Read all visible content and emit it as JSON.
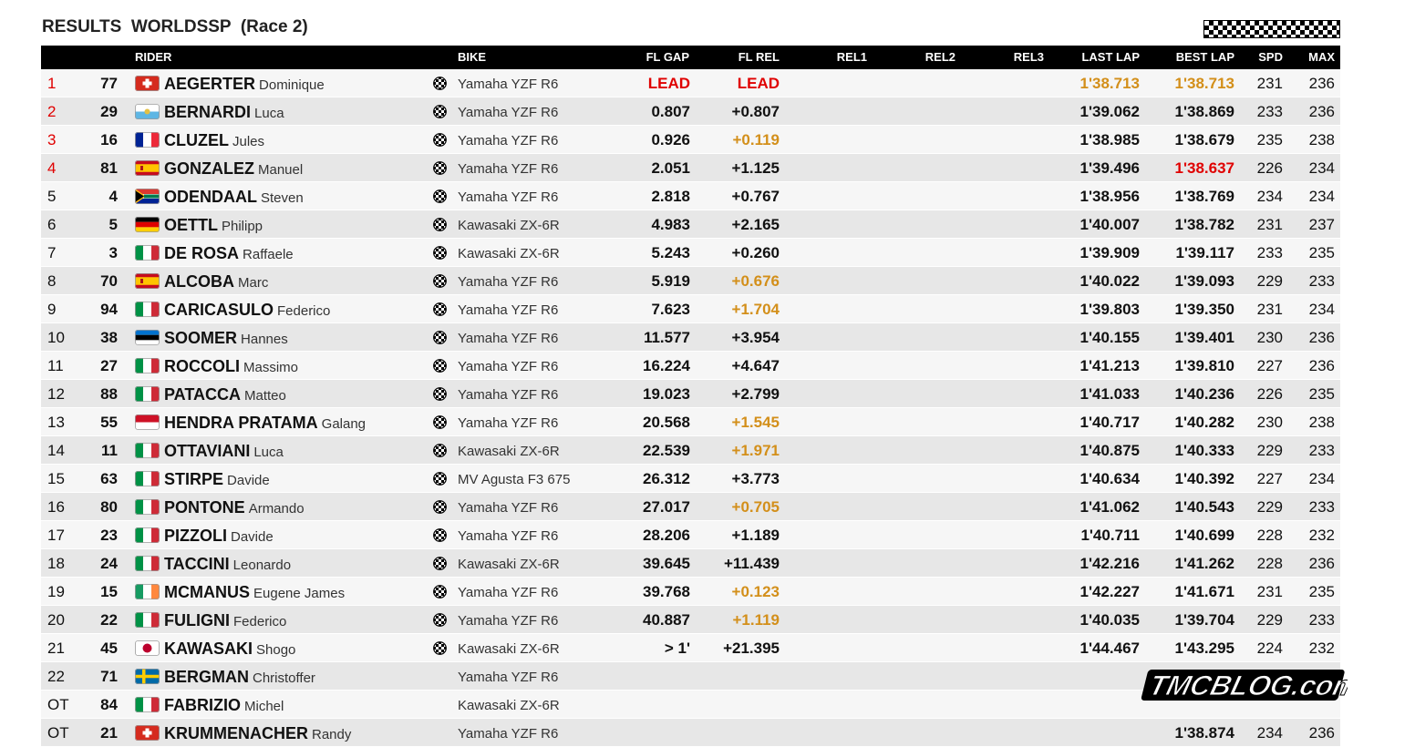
{
  "header": {
    "title": "RESULTS  WORLDSSP  (Race 2)"
  },
  "columns": {
    "rider": "RIDER",
    "bike": "BIKE",
    "fl_gap": "FL GAP",
    "fl_rel": "FL REL",
    "rel1": "REL1",
    "rel2": "REL2",
    "rel3": "REL3",
    "last_lap": "LAST LAP",
    "best_lap": "BEST LAP",
    "spd": "SPD",
    "max": "MAX"
  },
  "colors": {
    "header_bg": "#000000",
    "row_odd": "#f6f6f6",
    "row_even": "#e7e7e7",
    "highlight_red": "#e00000",
    "highlight_gold": "#d38f1a"
  },
  "rows": [
    {
      "pos": "1",
      "num": "77",
      "flag": "SUI",
      "surname": "AEGERTER",
      "firstname": "Dominique",
      "bike_icon": true,
      "bike": "Yamaha YZF R6",
      "fl_gap": "LEAD",
      "fl_rel": "LEAD",
      "last_lap": "1'38.713",
      "best_lap": "1'38.713",
      "spd": "231",
      "max": "236",
      "pos_color": "red",
      "gap_color": "red",
      "rel_color": "red",
      "last_color": "gold",
      "best_color": "gold"
    },
    {
      "pos": "2",
      "num": "29",
      "flag": "SMR",
      "surname": "BERNARDI",
      "firstname": "Luca",
      "bike_icon": true,
      "bike": "Yamaha YZF R6",
      "fl_gap": "0.807",
      "fl_rel": "+0.807",
      "last_lap": "1'39.062",
      "best_lap": "1'38.869",
      "spd": "233",
      "max": "236",
      "pos_color": "red",
      "gap_color": "",
      "rel_color": "",
      "last_color": "",
      "best_color": ""
    },
    {
      "pos": "3",
      "num": "16",
      "flag": "FRA",
      "surname": "CLUZEL",
      "firstname": "Jules",
      "bike_icon": true,
      "bike": "Yamaha YZF R6",
      "fl_gap": "0.926",
      "fl_rel": "+0.119",
      "last_lap": "1'38.985",
      "best_lap": "1'38.679",
      "spd": "235",
      "max": "238",
      "pos_color": "red",
      "gap_color": "",
      "rel_color": "gold",
      "last_color": "",
      "best_color": ""
    },
    {
      "pos": "4",
      "num": "81",
      "flag": "ESP",
      "surname": "GONZALEZ",
      "firstname": "Manuel",
      "bike_icon": true,
      "bike": "Yamaha YZF R6",
      "fl_gap": "2.051",
      "fl_rel": "+1.125",
      "last_lap": "1'39.496",
      "best_lap": "1'38.637",
      "spd": "226",
      "max": "234",
      "pos_color": "red",
      "gap_color": "",
      "rel_color": "",
      "last_color": "",
      "best_color": "red"
    },
    {
      "pos": "5",
      "num": "4",
      "flag": "RSA",
      "surname": "ODENDAAL",
      "firstname": "Steven",
      "bike_icon": true,
      "bike": "Yamaha YZF R6",
      "fl_gap": "2.818",
      "fl_rel": "+0.767",
      "last_lap": "1'38.956",
      "best_lap": "1'38.769",
      "spd": "234",
      "max": "234",
      "pos_color": "",
      "gap_color": "",
      "rel_color": "",
      "last_color": "",
      "best_color": ""
    },
    {
      "pos": "6",
      "num": "5",
      "flag": "GER",
      "surname": "OETTL",
      "firstname": "Philipp",
      "bike_icon": true,
      "bike": "Kawasaki ZX-6R",
      "fl_gap": "4.983",
      "fl_rel": "+2.165",
      "last_lap": "1'40.007",
      "best_lap": "1'38.782",
      "spd": "231",
      "max": "237",
      "pos_color": "",
      "gap_color": "",
      "rel_color": "",
      "last_color": "",
      "best_color": ""
    },
    {
      "pos": "7",
      "num": "3",
      "flag": "ITA",
      "surname": "DE ROSA",
      "firstname": "Raffaele",
      "bike_icon": true,
      "bike": "Kawasaki ZX-6R",
      "fl_gap": "5.243",
      "fl_rel": "+0.260",
      "last_lap": "1'39.909",
      "best_lap": "1'39.117",
      "spd": "233",
      "max": "235",
      "pos_color": "",
      "gap_color": "",
      "rel_color": "",
      "last_color": "",
      "best_color": ""
    },
    {
      "pos": "8",
      "num": "70",
      "flag": "ESP",
      "surname": "ALCOBA",
      "firstname": "Marc",
      "bike_icon": true,
      "bike": "Yamaha YZF R6",
      "fl_gap": "5.919",
      "fl_rel": "+0.676",
      "last_lap": "1'40.022",
      "best_lap": "1'39.093",
      "spd": "229",
      "max": "233",
      "pos_color": "",
      "gap_color": "",
      "rel_color": "gold",
      "last_color": "",
      "best_color": ""
    },
    {
      "pos": "9",
      "num": "94",
      "flag": "ITA",
      "surname": "CARICASULO",
      "firstname": "Federico",
      "bike_icon": true,
      "bike": "Yamaha YZF R6",
      "fl_gap": "7.623",
      "fl_rel": "+1.704",
      "last_lap": "1'39.803",
      "best_lap": "1'39.350",
      "spd": "231",
      "max": "234",
      "pos_color": "",
      "gap_color": "",
      "rel_color": "gold",
      "last_color": "",
      "best_color": ""
    },
    {
      "pos": "10",
      "num": "38",
      "flag": "EST",
      "surname": "SOOMER",
      "firstname": "Hannes",
      "bike_icon": true,
      "bike": "Yamaha YZF R6",
      "fl_gap": "11.577",
      "fl_rel": "+3.954",
      "last_lap": "1'40.155",
      "best_lap": "1'39.401",
      "spd": "230",
      "max": "236",
      "pos_color": "",
      "gap_color": "",
      "rel_color": "",
      "last_color": "",
      "best_color": ""
    },
    {
      "pos": "11",
      "num": "27",
      "flag": "ITA",
      "surname": "ROCCOLI",
      "firstname": "Massimo",
      "bike_icon": true,
      "bike": "Yamaha YZF R6",
      "fl_gap": "16.224",
      "fl_rel": "+4.647",
      "last_lap": "1'41.213",
      "best_lap": "1'39.810",
      "spd": "227",
      "max": "236",
      "pos_color": "",
      "gap_color": "",
      "rel_color": "",
      "last_color": "",
      "best_color": ""
    },
    {
      "pos": "12",
      "num": "88",
      "flag": "ITA",
      "surname": "PATACCA",
      "firstname": "Matteo",
      "bike_icon": true,
      "bike": "Yamaha YZF R6",
      "fl_gap": "19.023",
      "fl_rel": "+2.799",
      "last_lap": "1'41.033",
      "best_lap": "1'40.236",
      "spd": "226",
      "max": "235",
      "pos_color": "",
      "gap_color": "",
      "rel_color": "",
      "last_color": "",
      "best_color": ""
    },
    {
      "pos": "13",
      "num": "55",
      "flag": "INA",
      "surname": "HENDRA PRATAMA",
      "firstname": "Galang",
      "bike_icon": true,
      "bike": "Yamaha YZF R6",
      "fl_gap": "20.568",
      "fl_rel": "+1.545",
      "last_lap": "1'40.717",
      "best_lap": "1'40.282",
      "spd": "230",
      "max": "238",
      "pos_color": "",
      "gap_color": "",
      "rel_color": "gold",
      "last_color": "",
      "best_color": ""
    },
    {
      "pos": "14",
      "num": "11",
      "flag": "ITA",
      "surname": "OTTAVIANI",
      "firstname": "Luca",
      "bike_icon": true,
      "bike": "Kawasaki ZX-6R",
      "fl_gap": "22.539",
      "fl_rel": "+1.971",
      "last_lap": "1'40.875",
      "best_lap": "1'40.333",
      "spd": "229",
      "max": "233",
      "pos_color": "",
      "gap_color": "",
      "rel_color": "gold",
      "last_color": "",
      "best_color": ""
    },
    {
      "pos": "15",
      "num": "63",
      "flag": "ITA",
      "surname": "STIRPE",
      "firstname": "Davide",
      "bike_icon": true,
      "bike": "MV Agusta F3 675",
      "fl_gap": "26.312",
      "fl_rel": "+3.773",
      "last_lap": "1'40.634",
      "best_lap": "1'40.392",
      "spd": "227",
      "max": "234",
      "pos_color": "",
      "gap_color": "",
      "rel_color": "",
      "last_color": "",
      "best_color": ""
    },
    {
      "pos": "16",
      "num": "80",
      "flag": "ITA",
      "surname": "PONTONE",
      "firstname": "Armando",
      "bike_icon": true,
      "bike": "Yamaha YZF R6",
      "fl_gap": "27.017",
      "fl_rel": "+0.705",
      "last_lap": "1'41.062",
      "best_lap": "1'40.543",
      "spd": "229",
      "max": "233",
      "pos_color": "",
      "gap_color": "",
      "rel_color": "gold",
      "last_color": "",
      "best_color": ""
    },
    {
      "pos": "17",
      "num": "23",
      "flag": "ITA",
      "surname": "PIZZOLI",
      "firstname": "Davide",
      "bike_icon": true,
      "bike": "Yamaha YZF R6",
      "fl_gap": "28.206",
      "fl_rel": "+1.189",
      "last_lap": "1'40.711",
      "best_lap": "1'40.699",
      "spd": "228",
      "max": "232",
      "pos_color": "",
      "gap_color": "",
      "rel_color": "",
      "last_color": "",
      "best_color": ""
    },
    {
      "pos": "18",
      "num": "24",
      "flag": "ITA",
      "surname": "TACCINI",
      "firstname": "Leonardo",
      "bike_icon": true,
      "bike": "Kawasaki ZX-6R",
      "fl_gap": "39.645",
      "fl_rel": "+11.439",
      "last_lap": "1'42.216",
      "best_lap": "1'41.262",
      "spd": "228",
      "max": "236",
      "pos_color": "",
      "gap_color": "",
      "rel_color": "",
      "last_color": "",
      "best_color": ""
    },
    {
      "pos": "19",
      "num": "15",
      "flag": "IRL",
      "surname": "MCMANUS",
      "firstname": "Eugene James",
      "bike_icon": true,
      "bike": "Yamaha YZF R6",
      "fl_gap": "39.768",
      "fl_rel": "+0.123",
      "last_lap": "1'42.227",
      "best_lap": "1'41.671",
      "spd": "231",
      "max": "235",
      "pos_color": "",
      "gap_color": "",
      "rel_color": "gold",
      "last_color": "",
      "best_color": ""
    },
    {
      "pos": "20",
      "num": "22",
      "flag": "ITA",
      "surname": "FULIGNI",
      "firstname": "Federico",
      "bike_icon": true,
      "bike": "Yamaha YZF R6",
      "fl_gap": "40.887",
      "fl_rel": "+1.119",
      "last_lap": "1'40.035",
      "best_lap": "1'39.704",
      "spd": "229",
      "max": "233",
      "pos_color": "",
      "gap_color": "",
      "rel_color": "gold",
      "last_color": "",
      "best_color": ""
    },
    {
      "pos": "21",
      "num": "45",
      "flag": "JPN",
      "surname": "KAWASAKI",
      "firstname": "Shogo",
      "bike_icon": true,
      "bike": "Kawasaki ZX-6R",
      "fl_gap": "> 1'",
      "fl_rel": "+21.395",
      "last_lap": "1'44.467",
      "best_lap": "1'43.295",
      "spd": "224",
      "max": "232",
      "pos_color": "",
      "gap_color": "",
      "rel_color": "",
      "last_color": "",
      "best_color": ""
    },
    {
      "pos": "22",
      "num": "71",
      "flag": "SWE",
      "surname": "BERGMAN",
      "firstname": "Christoffer",
      "bike_icon": false,
      "bike": "Yamaha YZF R6",
      "fl_gap": "",
      "fl_rel": "",
      "last_lap": "",
      "best_lap": "",
      "spd": "",
      "max": "",
      "pos_color": "",
      "gap_color": "",
      "rel_color": "",
      "last_color": "",
      "best_color": ""
    },
    {
      "pos": "OT",
      "num": "84",
      "flag": "ITA",
      "surname": "FABRIZIO",
      "firstname": "Michel",
      "bike_icon": false,
      "bike": "Kawasaki ZX-6R",
      "fl_gap": "",
      "fl_rel": "",
      "last_lap": "",
      "best_lap": "",
      "spd": "",
      "max": "",
      "pos_color": "",
      "gap_color": "",
      "rel_color": "",
      "last_color": "",
      "best_color": ""
    },
    {
      "pos": "OT",
      "num": "21",
      "flag": "SUI",
      "surname": "KRUMMENACHER",
      "firstname": "Randy",
      "bike_icon": false,
      "bike": "Yamaha YZF R6",
      "fl_gap": "",
      "fl_rel": "",
      "last_lap": "",
      "best_lap": "1'38.874",
      "spd": "234",
      "max": "236",
      "pos_color": "",
      "gap_color": "",
      "rel_color": "",
      "last_color": "",
      "best_color": ""
    }
  ],
  "watermark": {
    "text": "TMCBLOG.com",
    "icon": "tmcblog-logo"
  }
}
